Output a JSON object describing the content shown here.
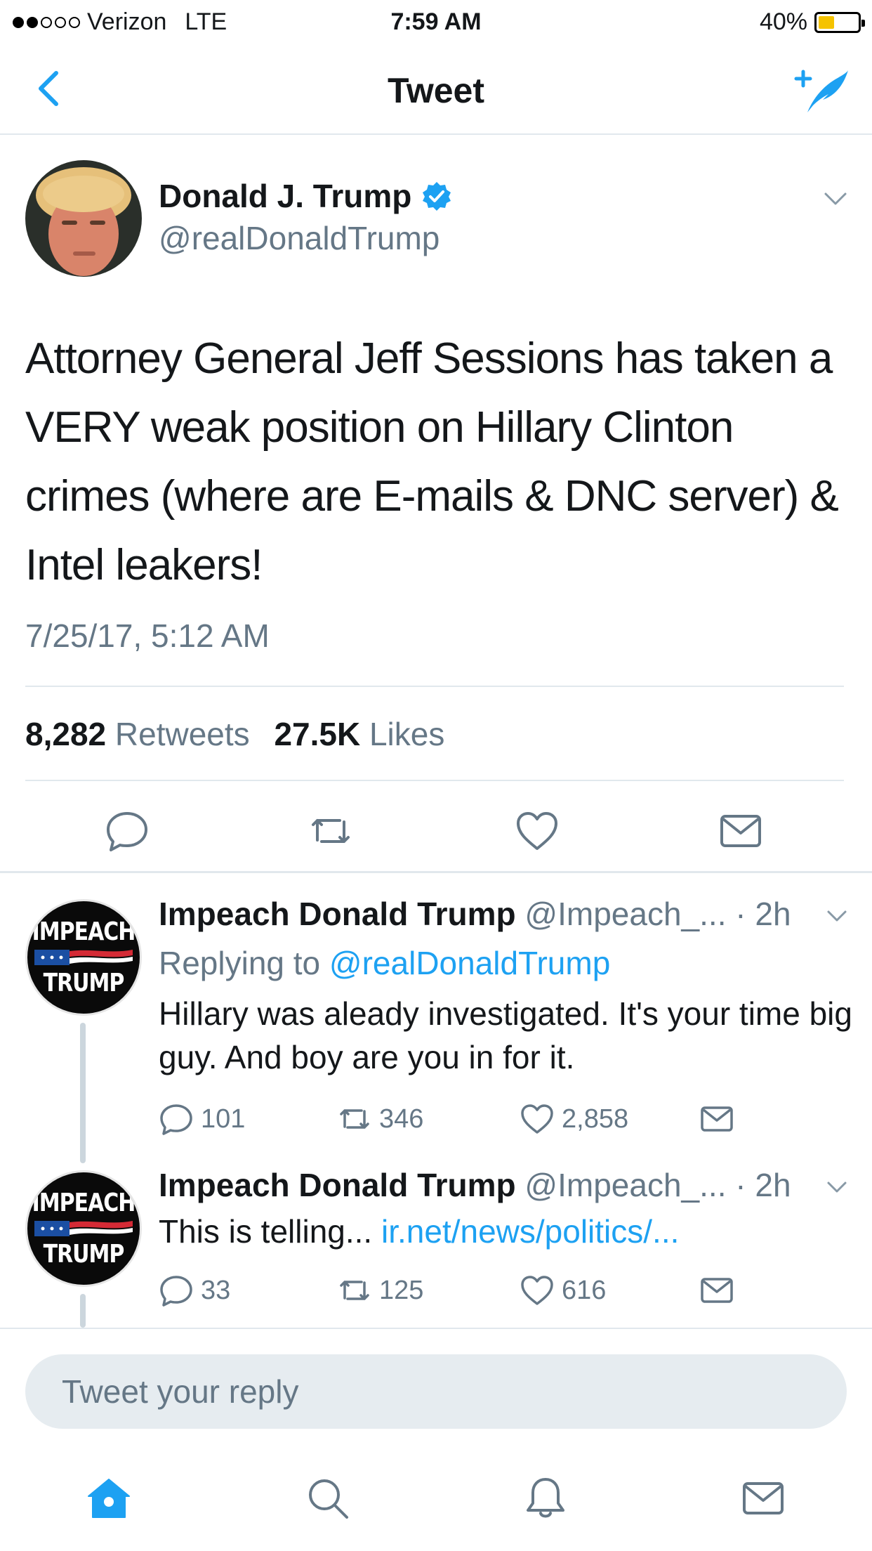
{
  "status": {
    "carrier": "Verizon",
    "network": "LTE",
    "time": "7:59 AM",
    "battery": "40%"
  },
  "nav": {
    "title": "Tweet"
  },
  "tweet": {
    "author_name": "Donald J. Trump",
    "handle": "@realDonaldTrump",
    "text": "Attorney General Jeff Sessions has taken a VERY weak position on Hillary Clinton crimes (where are E-mails & DNC server) & Intel leakers!",
    "timestamp": "7/25/17, 5:12 AM",
    "retweets_count": "8,282",
    "retweets_label": "Retweets",
    "likes_count": "27.5K",
    "likes_label": "Likes"
  },
  "replies": [
    {
      "name": "Impeach Donald Trump",
      "handle": "@Impeach_...",
      "time": "· 2h",
      "replying_prefix": "Replying to",
      "replying_to": "@realDonaldTrump",
      "text": "Hillary was aleady investigated. It's your time big guy. And boy are you in for it.",
      "replies": "101",
      "retweets": "346",
      "likes": "2,858",
      "avatar_top": "IMPEACH",
      "avatar_bottom": "TRUMP"
    },
    {
      "name": "Impeach Donald Trump",
      "handle": "@Impeach_...",
      "time": "· 2h",
      "text_prefix": "This is telling...",
      "link": "ir.net/news/politics/...",
      "replies": "33",
      "retweets": "125",
      "likes": "616",
      "avatar_top": "IMPEACH",
      "avatar_bottom": "TRUMP"
    }
  ],
  "reply_box": {
    "placeholder": "Tweet your reply"
  },
  "colors": {
    "accent": "#1da1f2",
    "muted": "#657786",
    "separator": "#e1e8ed",
    "battery": "#f5c300"
  },
  "icons": [
    "back-chevron-icon",
    "compose-tweet-icon",
    "verified-badge-icon",
    "chevron-down-icon",
    "reply-icon",
    "retweet-icon",
    "like-icon",
    "direct-message-icon",
    "home-icon",
    "search-icon",
    "notifications-icon",
    "messages-icon"
  ]
}
